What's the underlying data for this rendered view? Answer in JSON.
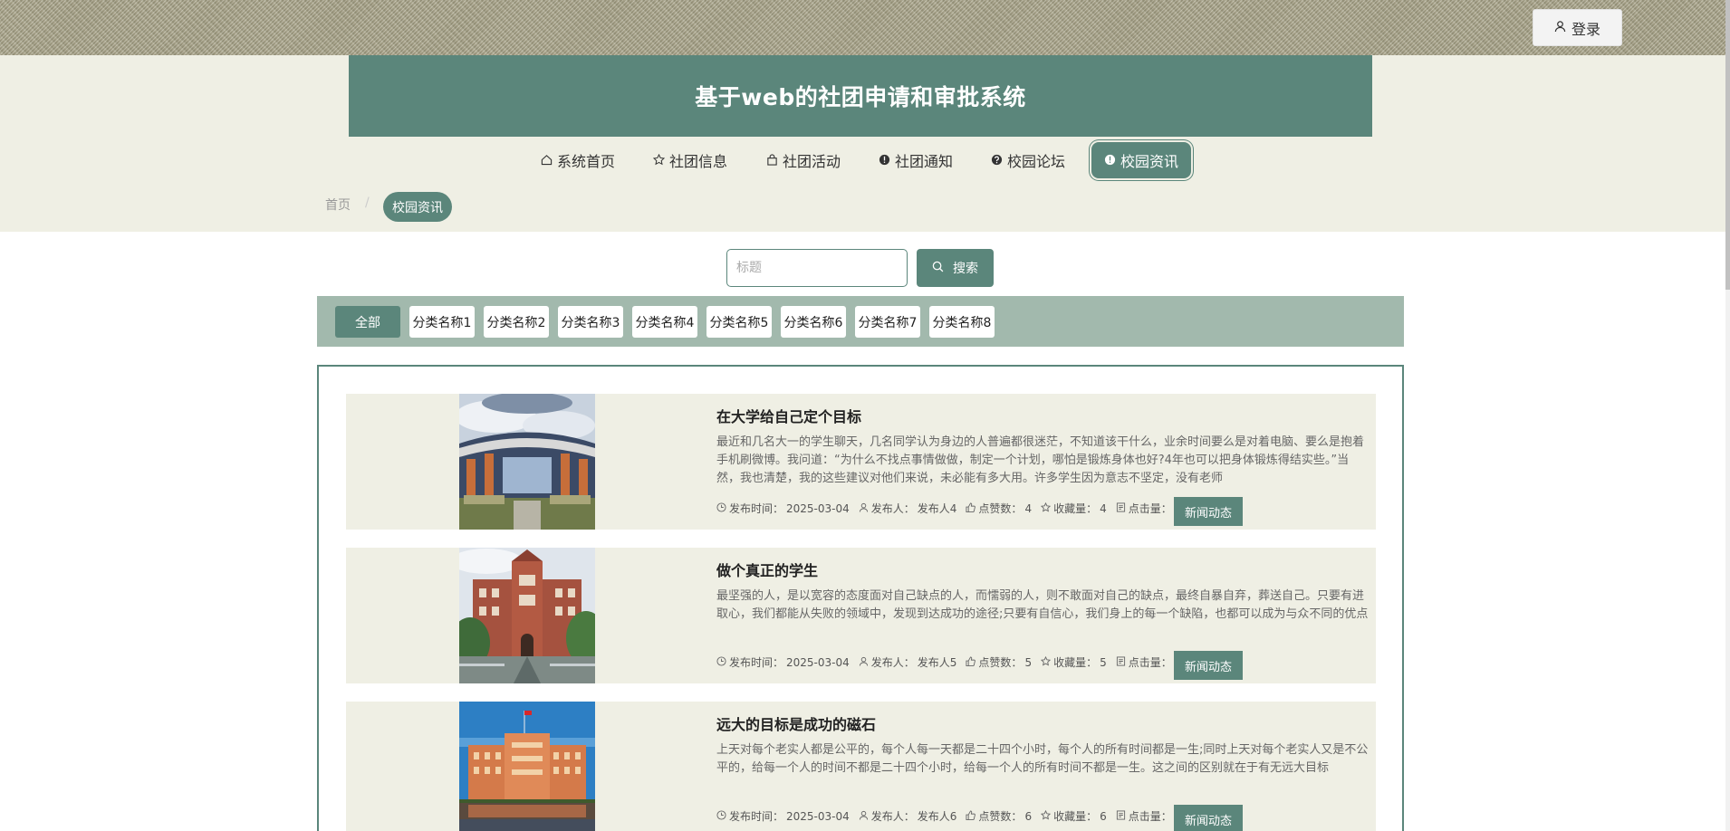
{
  "header": {
    "login_label": "登录",
    "site_title": "基于web的社团申请和审批系统"
  },
  "nav": {
    "items": [
      {
        "label": "系统首页",
        "icon": "home-icon"
      },
      {
        "label": "社团信息",
        "icon": "star-icon"
      },
      {
        "label": "社团活动",
        "icon": "bag-icon"
      },
      {
        "label": "社团通知",
        "icon": "info-circle-icon"
      },
      {
        "label": "校园论坛",
        "icon": "question-circle-icon"
      },
      {
        "label": "校园资讯",
        "icon": "info-circle-icon",
        "active": true
      }
    ]
  },
  "breadcrumb": {
    "home": "首页",
    "current": "校园资讯"
  },
  "search": {
    "placeholder": "标题",
    "value": "",
    "button_label": "搜索"
  },
  "categories": [
    "全部",
    "分类名称1",
    "分类名称2",
    "分类名称3",
    "分类名称4",
    "分类名称5",
    "分类名称6",
    "分类名称7",
    "分类名称8"
  ],
  "meta_labels": {
    "time": "发布时间：",
    "author": "发布人：",
    "likes": "点赞数：",
    "favorites": "收藏量：",
    "clicks": "点击量："
  },
  "articles": [
    {
      "title": "在大学给自己定个目标",
      "desc": "最近和几名大一的学生聊天，几名同学认为身边的人普遍都很迷茫，不知道该干什么，业余时间要么是对着电脑、要么是抱着手机刷微博。我问道：“为什么不找点事情做做，制定一个计划，哪怕是锻炼身体也好?4年也可以把身体锻炼得结实些。”当然，我也清楚，我的这些建议对他们来说，未必能有多大用。许多学生因为意志不坚定，没有老师",
      "time": "2025-03-04",
      "author": "发布人4",
      "likes": "4",
      "favorites": "4",
      "clicks": "4",
      "tag": "新闻动态"
    },
    {
      "title": "做个真正的学生",
      "desc": "最坚强的人，是以宽容的态度面对自己缺点的人，而懦弱的人，则不敢面对自己的缺点，最终自暴自弃，葬送自己。只要有进取心，我们都能从失败的领域中，发现到达成功的途径;只要有自信心，我们身上的每一个缺陷，也都可以成为与众不同的优点",
      "time": "2025-03-04",
      "author": "发布人5",
      "likes": "5",
      "favorites": "5",
      "clicks": "5",
      "tag": "新闻动态"
    },
    {
      "title": "远大的目标是成功的磁石",
      "desc": "上天对每个老实人都是公平的，每个人每一天都是二十四个小时，每个人的所有时间都是一生;同时上天对每个老实人又是不公平的，给每一个人的时间不都是二十四个小时，给每一个人的所有时间不都是一生。这之间的区别就在于有无远大目标",
      "time": "2025-03-04",
      "author": "发布人6",
      "likes": "6",
      "favorites": "6",
      "clicks": "6",
      "tag": "新闻动态"
    }
  ],
  "colors": {
    "primary": "#5b867b",
    "band": "#efefe4",
    "category_bar": "#a2b9ad"
  }
}
